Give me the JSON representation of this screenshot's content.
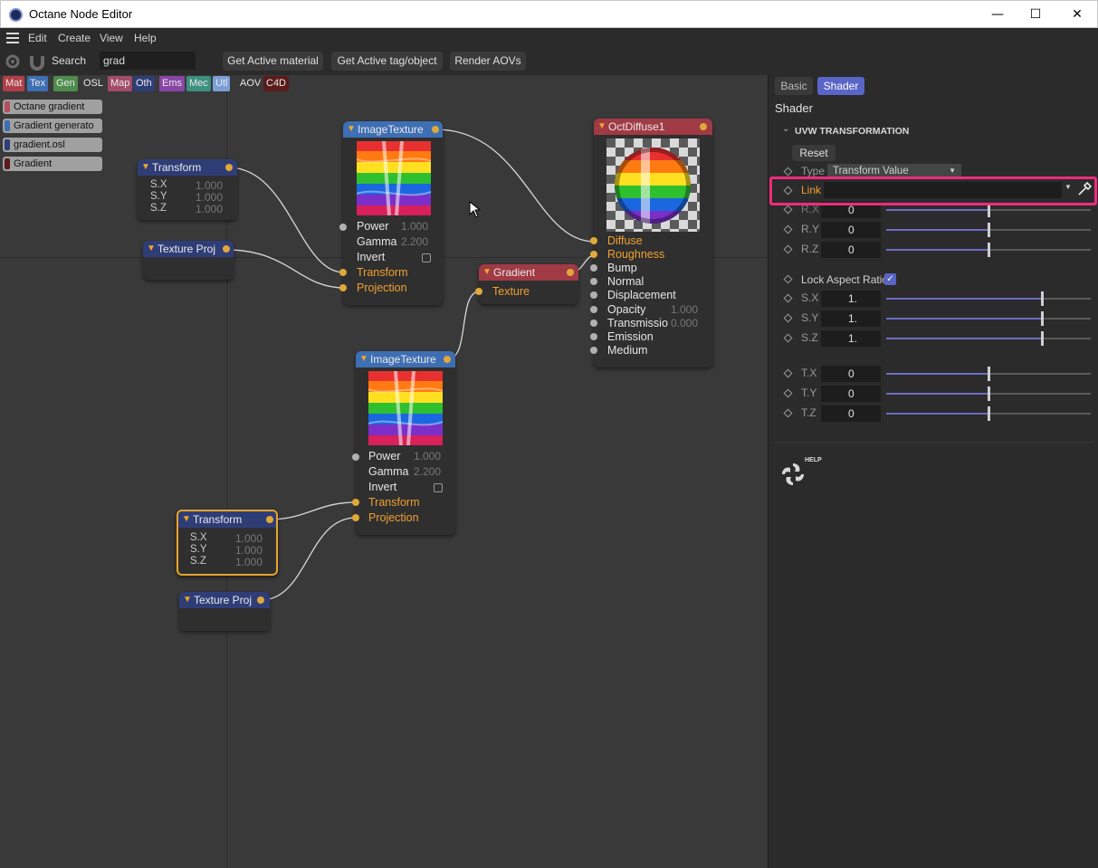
{
  "window": {
    "title": "Octane Node Editor",
    "minimize": "—",
    "maximize": "☐",
    "close": "✕"
  },
  "menu": [
    "Edit",
    "Create",
    "View",
    "Help"
  ],
  "toolbar": {
    "search_label": "Search",
    "search_value": "grad",
    "buttons": [
      "Get Active material",
      "Get Active tag/object",
      "Render AOVs"
    ]
  },
  "categories": [
    {
      "label": "Mat",
      "color": "#b13f49"
    },
    {
      "label": "Tex",
      "color": "#3e6fb4"
    },
    {
      "label": "Gen",
      "color": "#4f8c4d"
    },
    {
      "label": "OSL",
      "color": "#3a3a3a"
    },
    {
      "label": "Map",
      "color": "#a24c68"
    },
    {
      "label": "Oth",
      "color": "#2f3d77"
    },
    {
      "label": "Ems",
      "color": "#8a46a6"
    },
    {
      "label": "Mec",
      "color": "#3d8f7e"
    },
    {
      "label": "Utl",
      "color": "#7b9ed6"
    },
    {
      "label": "AOV",
      "color": "#3a3a3a"
    },
    {
      "label": "C4D",
      "color": "#5a1b1b"
    }
  ],
  "results": [
    {
      "label": "Octane gradient",
      "color": "#b34f5e"
    },
    {
      "label": "Gradient generato",
      "color": "#3e6fb4"
    },
    {
      "label": "gradient.osl",
      "color": "#2f3d77"
    },
    {
      "label": "Gradient",
      "color": "#5a1b1b"
    }
  ],
  "nodes": {
    "transform1": {
      "title": "Transform",
      "pins": [
        "S.X",
        "S.Y",
        "S.Z"
      ],
      "values": [
        "1.000",
        "1.000",
        "1.000"
      ]
    },
    "textureproj1": {
      "title": "Texture Proj"
    },
    "imagetex1": {
      "title": "ImageTexture",
      "pins": [
        "Power",
        "Gamma",
        "Invert",
        "Transform",
        "Projection"
      ],
      "values": [
        "1.000",
        "2.200"
      ]
    },
    "gradient": {
      "title": "Gradient",
      "pins": [
        "Texture"
      ]
    },
    "diffuse": {
      "title": "OctDiffuse1",
      "pins": [
        "Diffuse",
        "Roughness",
        "Bump",
        "Normal",
        "Displacement",
        "Opacity",
        "Transmissio",
        "Emission",
        "Medium"
      ],
      "values": {
        "opacity": "1.000",
        "transmission": "0.000"
      }
    },
    "imagetex2": {
      "title": "ImageTexture",
      "pins": [
        "Power",
        "Gamma",
        "Invert",
        "Transform",
        "Projection"
      ],
      "values": [
        "1.000",
        "2.200"
      ]
    },
    "transform2": {
      "title": "Transform",
      "pins": [
        "S.X",
        "S.Y",
        "S.Z"
      ],
      "values": [
        "1.000",
        "1.000",
        "1.000"
      ]
    },
    "textureproj2": {
      "title": "Texture Proj"
    }
  },
  "panel": {
    "tabs": [
      "Basic",
      "Shader"
    ],
    "active_tab": "Shader",
    "heading": "Shader",
    "section": "UVW TRANSFORMATION",
    "reset": "Reset",
    "type_label": "Type",
    "type_value": "Transform Value",
    "link_label": "Link",
    "link_value": "",
    "rotation": [
      {
        "label": "R.X",
        "value": "0",
        "fraction": 0.5
      },
      {
        "label": "R.Y",
        "value": "0",
        "fraction": 0.5
      },
      {
        "label": "R.Z",
        "value": "0",
        "fraction": 0.5
      }
    ],
    "lock_label": "Lock Aspect Ratio",
    "lock_checked": true,
    "scale": [
      {
        "label": "S.X",
        "value": "1.",
        "fraction": 0.76
      },
      {
        "label": "S.Y",
        "value": "1.",
        "fraction": 0.76
      },
      {
        "label": "S.Z",
        "value": "1.",
        "fraction": 0.76
      }
    ],
    "translation": [
      {
        "label": "T.X",
        "value": "0",
        "fraction": 0.5
      },
      {
        "label": "T.Y",
        "value": "0",
        "fraction": 0.5
      },
      {
        "label": "T.Z",
        "value": "0",
        "fraction": 0.5
      }
    ],
    "help": "HELP"
  },
  "colors": {
    "highlight": "#ef2b7c",
    "pin_orange": "#f0a030",
    "slider": "#6c6cc4"
  }
}
